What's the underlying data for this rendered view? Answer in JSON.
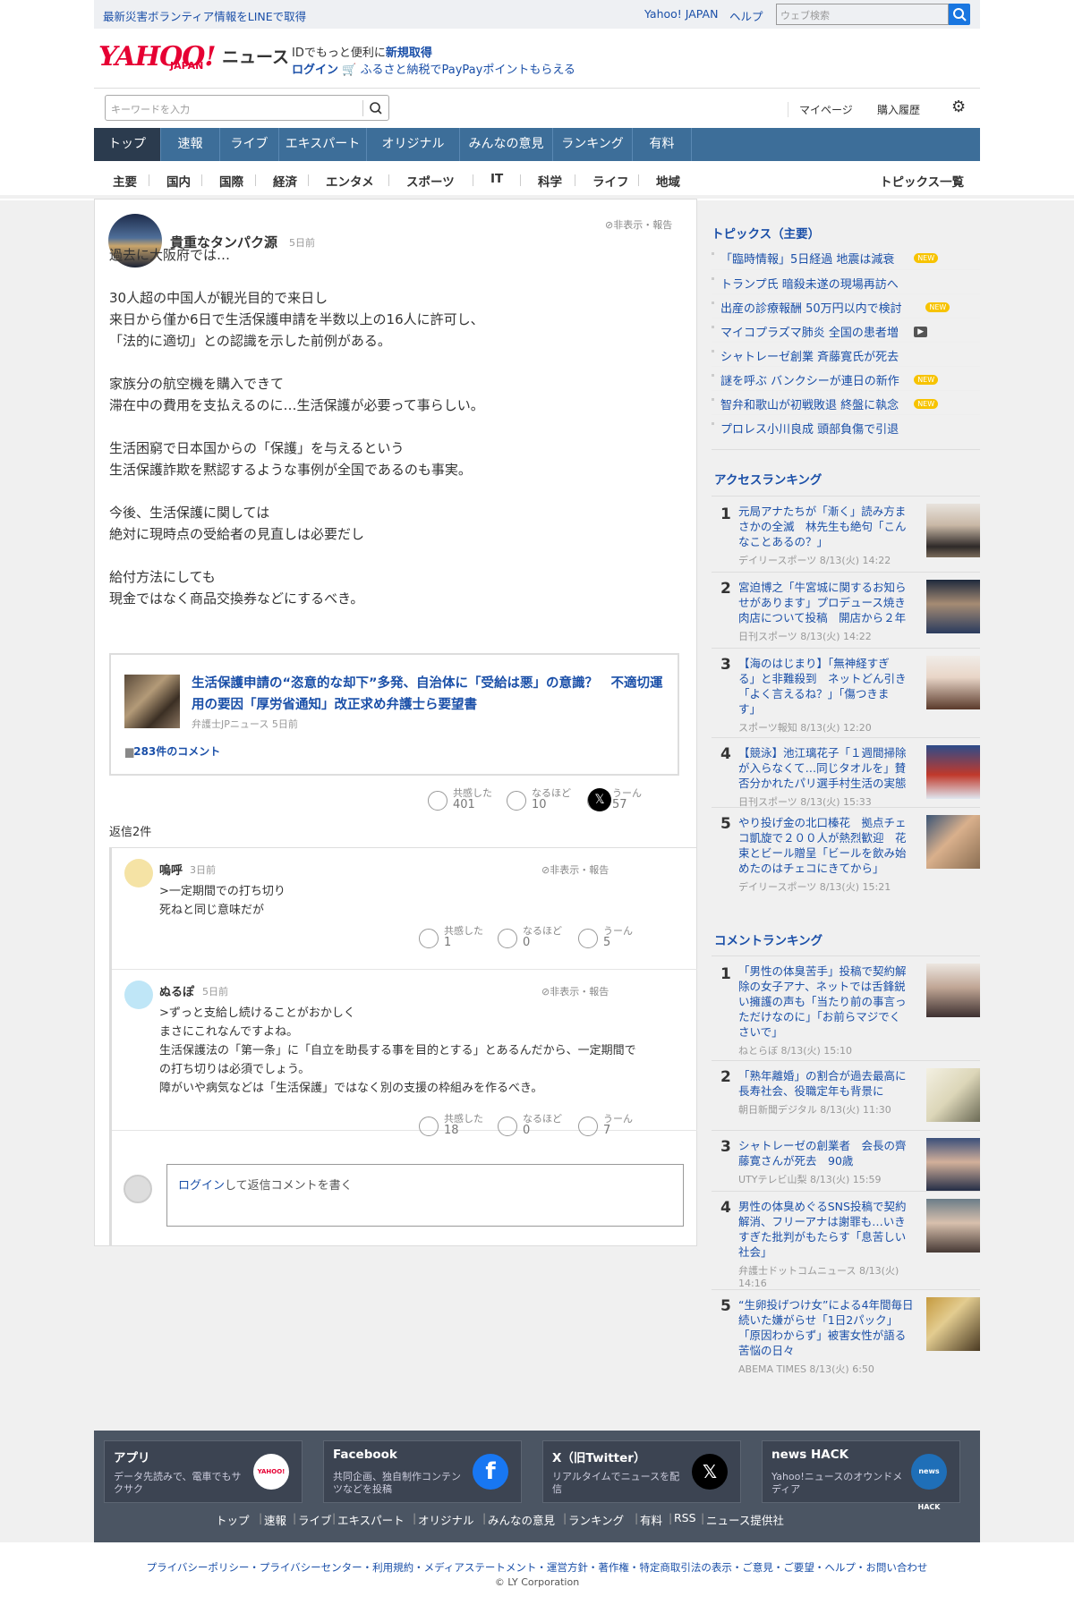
{
  "topbar": {
    "line_link": "最新災害ボランティア情報をLINEで取得",
    "yahoo_japan": "Yahoo! JAPAN",
    "help": "ヘルプ",
    "web_search_placeholder": "ウェブ検索"
  },
  "header": {
    "logo": "YAHOO!",
    "logo_japan": "JAPAN",
    "logo_news": "ニュース",
    "id_text": "IDでもっと便利に",
    "id_link": "新規取得",
    "login": "ログイン",
    "furusato": "ふるさと納税でPayPayポイントもらえる",
    "keyword_placeholder": "キーワードを入力",
    "mypage": "マイページ",
    "purchase_history": "購入履歴"
  },
  "global_nav": [
    "トップ",
    "速報",
    "ライブ",
    "エキスパート",
    "オリジナル",
    "みんなの意見",
    "ランキング",
    "有料"
  ],
  "sub_nav": [
    "主要",
    "国内",
    "国際",
    "経済",
    "エンタメ",
    "スポーツ",
    "IT",
    "科学",
    "ライフ",
    "地域"
  ],
  "sub_nav_topics": "トピックス一覧",
  "comment": {
    "author": "貴重なタンパク源",
    "time": "5日前",
    "hide_report": "非表示・報告",
    "paragraphs": [
      [
        "過去に大阪府では…"
      ],
      [
        "30人超の中国人が観光目的で来日し",
        "来日から僅か6日で生活保護申請を半数以上の16人に許可し、",
        "「法的に適切」との認識を示した前例がある。"
      ],
      [
        "家族分の航空機を購入できて",
        "滞在中の費用を支払えるのに…生活保護が必要って事らしい。"
      ],
      [
        "生活困窮で日本国からの「保護」を与えるという",
        "生活保護詐欺を黙認するような事例が全国であるのも事実。"
      ],
      [
        "今後、生活保護に関しては",
        "絶対に現時点の受給者の見直しは必要だし"
      ],
      [
        "給付方法にしても",
        "現金ではなく商品交換券などにするべき。"
      ]
    ],
    "article": {
      "title": "生活保護申請の“恣意的な却下”多発、自治体に「受給は悪」の意識？　不適切運用の要因「厚労省通知」改正求め弁護士ら要望書",
      "source": "弁護士JPニュース 5日前",
      "comments": "283件のコメント"
    },
    "reactions": [
      {
        "label": "共感した",
        "count": "401"
      },
      {
        "label": "なるほど",
        "count": "10"
      },
      {
        "label": "うーん",
        "count": "57"
      }
    ],
    "x_icon": "𝕏",
    "replies_label": "返信2件"
  },
  "replies": [
    {
      "name": "嗚呼",
      "time": "3日前",
      "hide_report": "非表示・報告",
      "lines": [
        ">一定期間での打ち切り",
        "死ねと同じ意味だが"
      ],
      "reactions": [
        {
          "label": "共感した",
          "count": "1"
        },
        {
          "label": "なるほど",
          "count": "0"
        },
        {
          "label": "うーん",
          "count": "5"
        }
      ]
    },
    {
      "name": "ぬるぽ",
      "time": "5日前",
      "hide_report": "非表示・報告",
      "lines": [
        ">ずっと支給し続けることがおかしく",
        "まさにこれなんですよね。",
        "生活保護法の「第一条」に「自立を助長する事を目的とする」とあるんだから、一定期間で",
        "の打ち切りは必須でしょう。",
        "障がいや病気などは「生活保護」ではなく別の支援の枠組みを作るべき。"
      ],
      "reactions": [
        {
          "label": "共感した",
          "count": "18"
        },
        {
          "label": "なるほど",
          "count": "0"
        },
        {
          "label": "うーん",
          "count": "7"
        }
      ]
    }
  ],
  "reply_input": {
    "login": "ログイン",
    "rest": "して返信コメントを書く"
  },
  "topics": {
    "heading": "トピックス（主要）",
    "items": [
      {
        "text": "「臨時情報」5日経過 地震は減衰",
        "badge": "NEW"
      },
      {
        "text": "トランプ氏 暗殺未遂の現場再訪へ",
        "badge": ""
      },
      {
        "text": "出産の診療報酬 50万円以内で検討",
        "badge": "NEW"
      },
      {
        "text": "マイコプラズマ肺炎 全国の患者増",
        "badge": "▶"
      },
      {
        "text": "シャトレーゼ創業 斉藤寛氏が死去",
        "badge": ""
      },
      {
        "text": "謎を呼ぶ バンクシーが連日の新作",
        "badge": "NEW"
      },
      {
        "text": "智弁和歌山が初戦敗退 終盤に執念",
        "badge": "NEW"
      },
      {
        "text": "プロレス小川良成 頭部負傷で引退",
        "badge": ""
      }
    ]
  },
  "access_ranking": {
    "heading": "アクセスランキング",
    "items": [
      {
        "rank": "1",
        "lines": [
          "元局アナたちが「漸く」読み方ま",
          "さかの全滅　林先生も絶句「こん",
          "なことあるの？」"
        ],
        "source": "デイリースポーツ 8/13(火) 14:22"
      },
      {
        "rank": "2",
        "lines": [
          "宮迫博之「牛宮城に関するお知ら",
          "せがあります」プロデュース焼き",
          "肉店について投稿　開店から２年"
        ],
        "source": "日刊スポーツ 8/13(火) 14:22"
      },
      {
        "rank": "3",
        "lines": [
          "【海のはじまり】「無神経すぎ",
          "る」と非難殺到　ネットどん引き",
          "「よく言えるね？」「傷つきま",
          "す」"
        ],
        "source": "スポーツ報知 8/13(火) 12:20"
      },
      {
        "rank": "4",
        "lines": [
          "【競泳】池江璃花子「１週間掃除",
          "が入らなくて…同じタオルを」賛",
          "否分かれたパリ選手村生活の実態"
        ],
        "source": "日刊スポーツ 8/13(火) 15:33"
      },
      {
        "rank": "5",
        "lines": [
          "やり投げ金の北口榛花　拠点チェ",
          "コ凱旋で２００人が熱烈歓迎　花",
          "束とビール贈呈「ビールを飲み始",
          "めたのはチェコにきてから」"
        ],
        "source": "デイリースポーツ 8/13(火) 15:21"
      }
    ]
  },
  "comment_ranking": {
    "heading": "コメントランキング",
    "items": [
      {
        "rank": "1",
        "lines": [
          "「男性の体臭苦手」投稿で契約解",
          "除の女子アナ、ネットでは舌鋒鋭",
          "い擁護の声も「当たり前の事言っ",
          "ただけなのに」「お前らマジでく",
          "さいで」"
        ],
        "source": "ねとらぼ 8/13(火) 15:10"
      },
      {
        "rank": "2",
        "lines": [
          "「熟年離婚」の割合が過去最高に",
          "長寿社会、役職定年も背景に"
        ],
        "source": "朝日新聞デジタル 8/13(火) 11:30"
      },
      {
        "rank": "3",
        "lines": [
          "シャトレーゼの創業者　会長の齊",
          "藤寛さんが死去　90歳"
        ],
        "source": "UTYテレビ山梨 8/13(火) 15:59"
      },
      {
        "rank": "4",
        "lines": [
          "男性の体臭めぐるSNS投稿で契約",
          "解消、フリーアナは謝罪も…いき",
          "すぎた批判がもたらす「息苦しい",
          "社会」"
        ],
        "source": "弁護士ドットコムニュース 8/13(火)",
        "source2": "14:16"
      },
      {
        "rank": "5",
        "lines": [
          "“生卵投げつけ女”による4年間毎日",
          "続いた嫌がらせ「1日2パック」",
          "「原因わからず」被害女性が語る",
          "苦悩の日々"
        ],
        "source": "ABEMA TIMES 8/13(火) 6:50"
      }
    ]
  },
  "footer": {
    "boxes": [
      {
        "title": "アプリ",
        "desc": "データ先読みで、電車でもサクサク",
        "icon": "YAHOO!"
      },
      {
        "title": "Facebook",
        "desc": "共同企画、独自制作コンテンツなどを投稿",
        "icon": "f"
      },
      {
        "title": "X（旧Twitter）",
        "desc": "リアルタイムでニュースを配信",
        "icon": "𝕏"
      },
      {
        "title": "news HACK",
        "desc": "Yahoo!ニュースのオウンドメディア",
        "icon": "news HACK"
      }
    ],
    "links": [
      "トップ",
      "速報",
      "ライブ",
      "エキスパート",
      "オリジナル",
      "みんなの意見",
      "ランキング",
      "有料",
      "RSS",
      "ニュース提供社"
    ],
    "policy": "プライバシーポリシー・プライバシーセンター・利用規約・メディアステートメント・運営方針・著作権・特定商取引法の表示・ご意見・ご要望・ヘルプ・お問い合わせ",
    "copyright": "© LY Corporation"
  }
}
